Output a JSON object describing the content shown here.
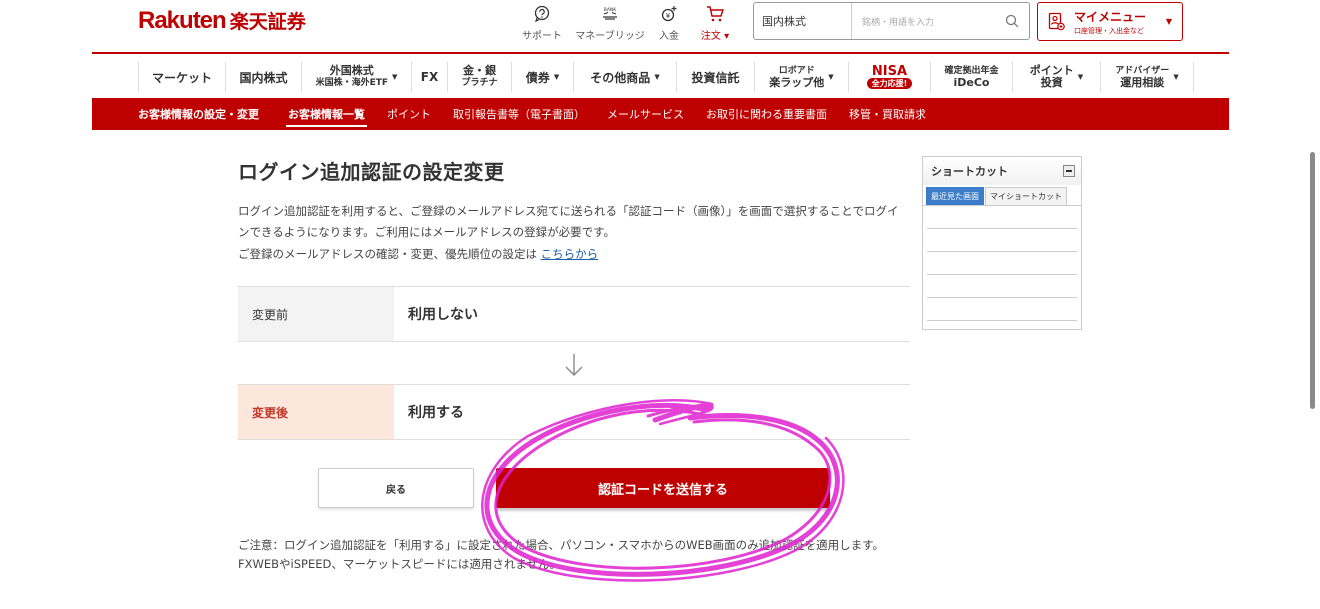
{
  "header": {
    "logo_en": "Rakuten",
    "logo_jp": "楽天証券",
    "utilities": [
      {
        "label": "サポート",
        "icon": "support-icon"
      },
      {
        "label": "マネーブリッジ",
        "icon": "bank-icon"
      },
      {
        "label": "入金",
        "icon": "deposit-icon"
      },
      {
        "label": "注文 ▾",
        "icon": "cart-icon"
      }
    ],
    "bank_icon_text": "BANK",
    "search": {
      "select_value": "国内株式",
      "placeholder": "銘柄・用語を入力"
    },
    "mymenu": {
      "title": "マイメニュー",
      "subtitle": "口座管理・入出金など"
    }
  },
  "global_nav": {
    "market": "マーケット",
    "domestic": "国内株式",
    "foreign_l1": "外国株式",
    "foreign_l2": "米国株・海外ETF",
    "fx": "FX",
    "gold_l1": "金・銀",
    "gold_l2": "プラチナ",
    "bonds": "債券",
    "other": "その他商品",
    "funds": "投資信託",
    "robo_l1": "ロボアド",
    "robo_l2": "楽ラップ他",
    "nisa_title": "NISA",
    "nisa_sub": "全力応援!",
    "ideco_l1": "確定拠出年金",
    "ideco_l2": "iDeCo",
    "points_l1": "ポイント",
    "points_l2": "投資",
    "advisor_l1": "アドバイザー",
    "advisor_l2": "運用相談"
  },
  "sub_nav": {
    "title": "お客様情報の設定・変更",
    "items": [
      "お客様情報一覧",
      "ポイント",
      "取引報告書等（電子書面）",
      "メールサービス",
      "お取引に関わる重要書面",
      "移管・買取請求"
    ]
  },
  "main": {
    "title": "ログイン追加認証の設定変更",
    "description": "ログイン追加認証を利用すると、ご登録のメールアドレス宛てに送られる「認証コード（画像）」を画面で選択することでログインできるようになります。ご利用にはメールアドレスの登録が必要です。",
    "email_prefix": "ご登録のメールアドレスの確認・変更、優先順位の設定は",
    "email_link": "こちらから",
    "before_label": "変更前",
    "before_value": "利用しない",
    "after_label": "変更後",
    "after_value": "利用する",
    "back_button": "戻る",
    "send_button": "認証コードを送信する",
    "note": "ご注意：ログイン追加認証を「利用する」に設定された場合、パソコン・スマホからのWEB画面のみ追加認証を適用します。FXWEBやiSPEED、マーケットスピードには適用されません。"
  },
  "shortcut": {
    "title": "ショートカット",
    "tabs": [
      "最近見た画面",
      "マイショートカット"
    ]
  },
  "colors": {
    "brand_red": "#bf0000",
    "annotation_magenta": "#e020d0"
  }
}
